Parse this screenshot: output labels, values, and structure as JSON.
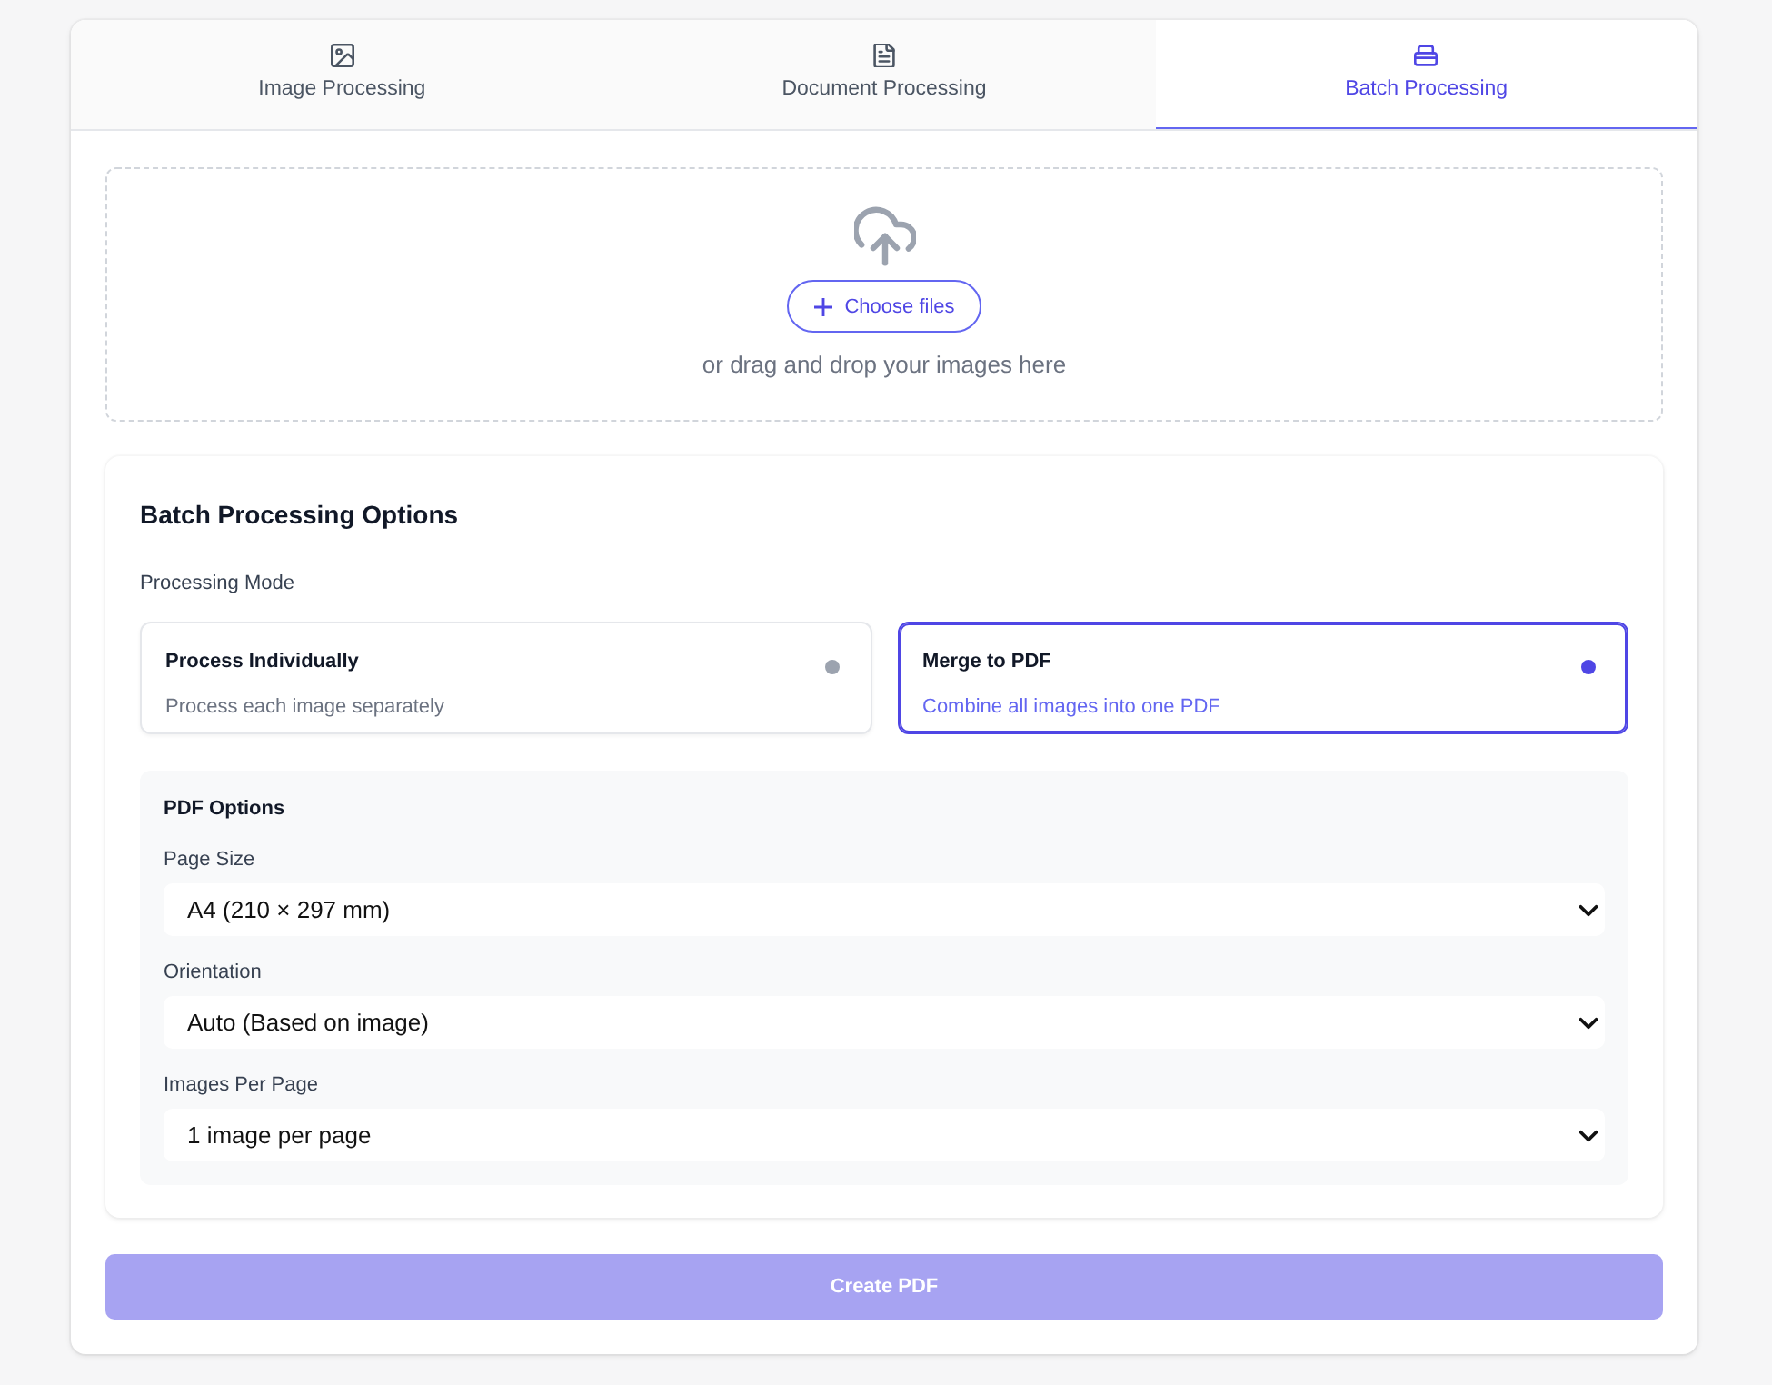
{
  "tabs": [
    {
      "label": "Image Processing",
      "selected": false
    },
    {
      "label": "Document Processing",
      "selected": false
    },
    {
      "label": "Batch Processing",
      "selected": true
    }
  ],
  "upload": {
    "button": "Choose files",
    "hint": "or drag and drop your images here"
  },
  "batch_options": {
    "title": "Batch Processing Options",
    "mode_label": "Processing Mode",
    "modes": [
      {
        "title": "Process Individually",
        "description": "Process each image separately",
        "selected": false
      },
      {
        "title": "Merge to PDF",
        "description": "Combine all images into one PDF",
        "selected": true
      }
    ],
    "pdf_options": {
      "title": "PDF Options",
      "fields": [
        {
          "label": "Page Size",
          "value": "A4 (210 × 297 mm)"
        },
        {
          "label": "Orientation",
          "value": "Auto (Based on image)"
        },
        {
          "label": "Images Per Page",
          "value": "1 image per page"
        }
      ]
    }
  },
  "create_button": {
    "label": "Create PDF",
    "disabled": true
  }
}
